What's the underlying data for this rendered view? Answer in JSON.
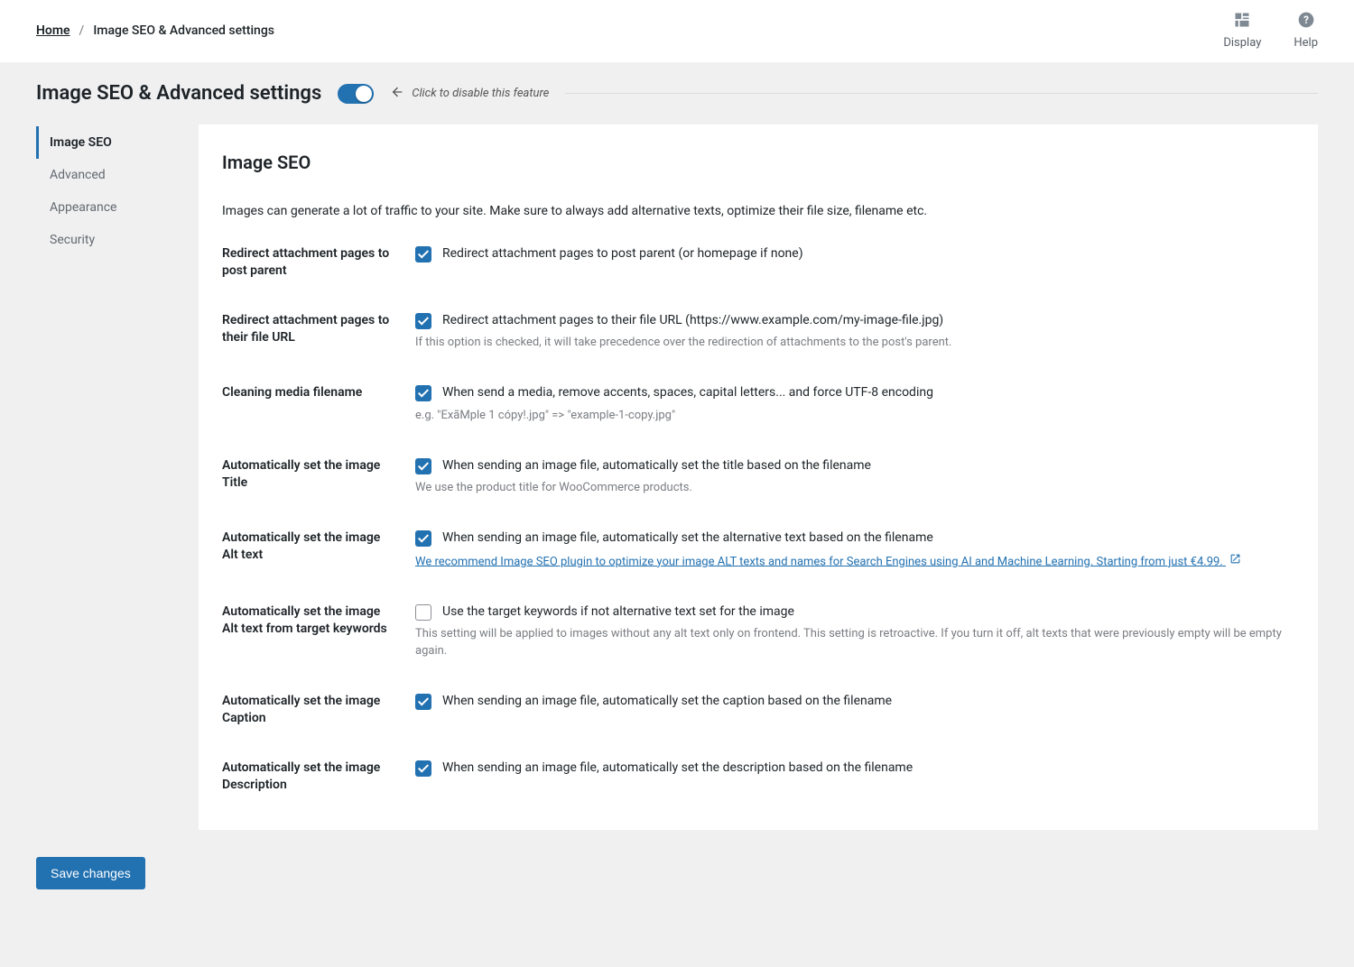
{
  "breadcrumb": {
    "home": "Home",
    "sep": "/",
    "current": "Image SEO & Advanced settings"
  },
  "topTools": {
    "display": "Display",
    "help": "Help"
  },
  "pageTitle": "Image SEO & Advanced settings",
  "toggleHint": "Click to disable this feature",
  "tabs": {
    "imageSeo": "Image SEO",
    "advanced": "Advanced",
    "appearance": "Appearance",
    "security": "Security"
  },
  "panel": {
    "heading": "Image SEO",
    "description": "Images can generate a lot of traffic to your site. Make sure to always add alternative texts, optimize their file size, filename etc."
  },
  "settings": {
    "redirectParent": {
      "label": "Redirect attachment pages to post parent",
      "checkText": "Redirect attachment pages to post parent (or homepage if none)"
    },
    "redirectFile": {
      "label": "Redirect attachment pages to their file URL",
      "checkText": "Redirect attachment pages to their file URL (https://www.example.com/my-image-file.jpg)",
      "help": "If this option is checked, it will take precedence over the redirection of attachments to the post's parent."
    },
    "cleanFilename": {
      "label": "Cleaning media filename",
      "checkText": "When send a media, remove accents, spaces, capital letters... and force UTF-8 encoding",
      "help": "e.g. \"ExãMple 1 cópy!.jpg\" => \"example-1-copy.jpg\""
    },
    "autoTitle": {
      "label": "Automatically set the image Title",
      "checkText": "When sending an image file, automatically set the title based on the filename",
      "help": "We use the product title for WooCommerce products."
    },
    "autoAlt": {
      "label": "Automatically set the image Alt text",
      "checkText": "When sending an image file, automatically set the alternative text based on the filename",
      "link": "We recommend Image SEO plugin to optimize your image ALT texts and names for Search Engines using AI and Machine Learning. Starting from just €4.99."
    },
    "autoAltKeywords": {
      "label": "Automatically set the image Alt text from target keywords",
      "checkText": "Use the target keywords if not alternative text set for the image",
      "help": "This setting will be applied to images without any alt text only on frontend. This setting is retroactive. If you turn it off, alt texts that were previously empty will be empty again."
    },
    "autoCaption": {
      "label": "Automatically set the image Caption",
      "checkText": "When sending an image file, automatically set the caption based on the filename"
    },
    "autoDescription": {
      "label": "Automatically set the image Description",
      "checkText": "When sending an image file, automatically set the description based on the filename"
    }
  },
  "saveButton": "Save changes"
}
